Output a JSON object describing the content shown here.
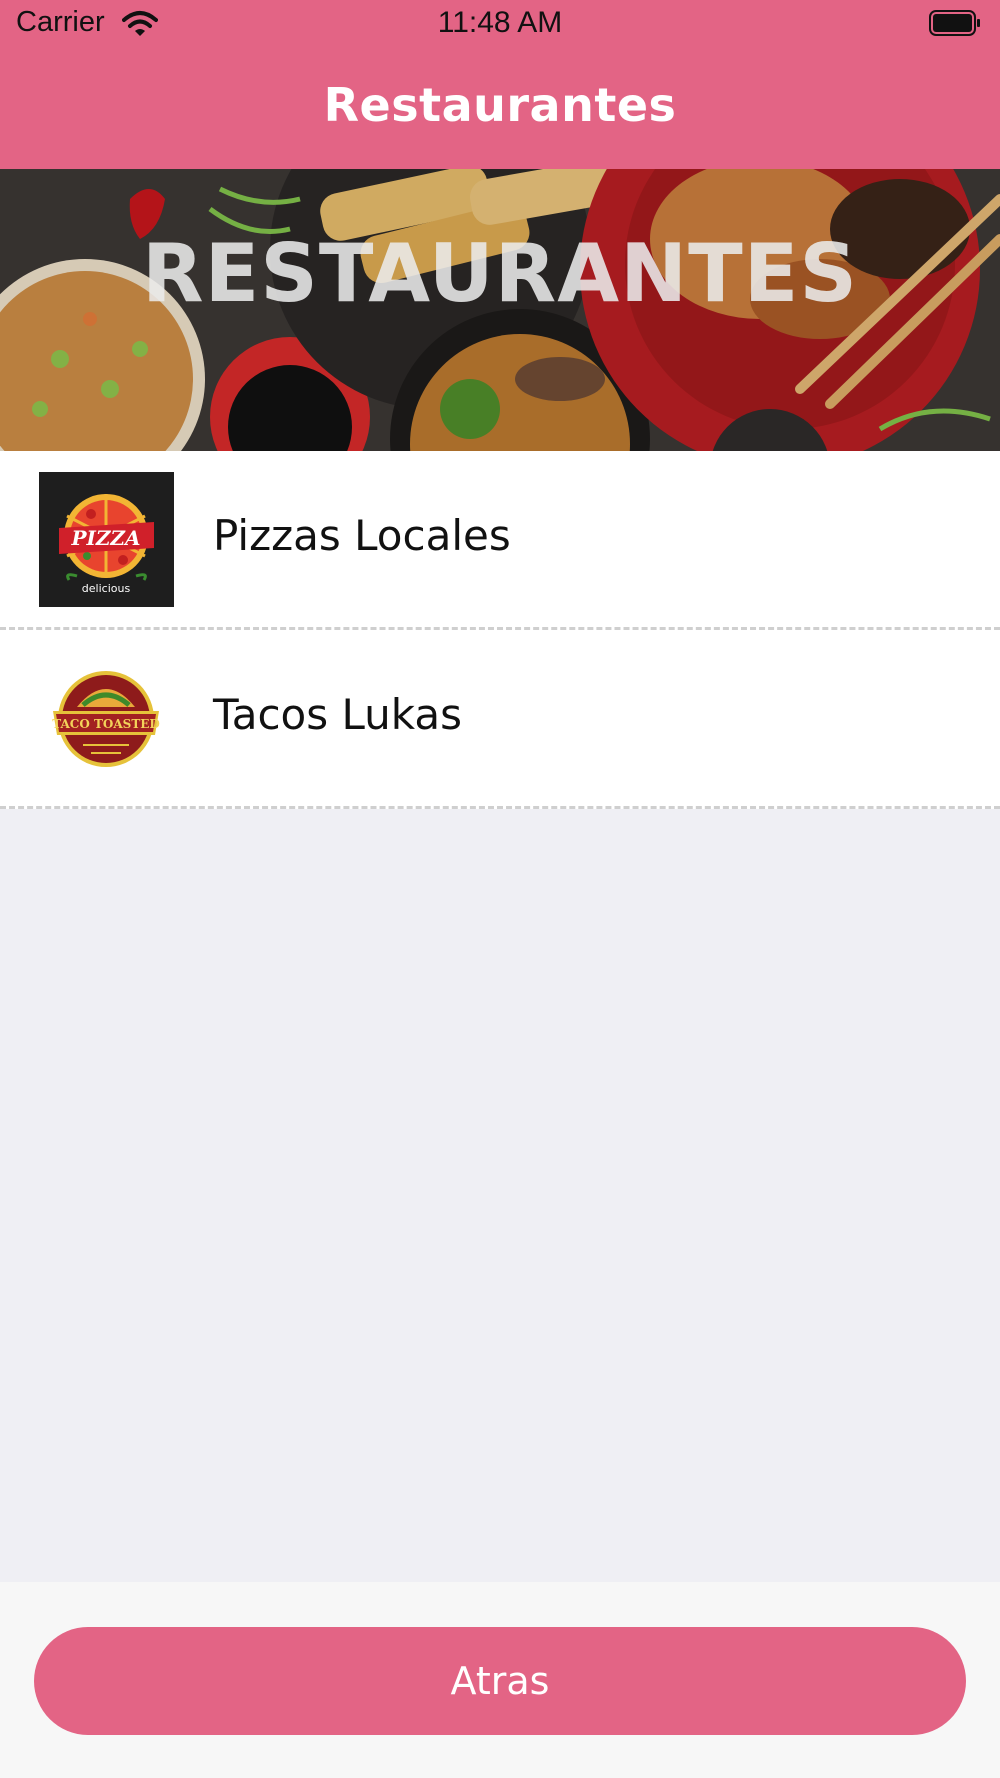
{
  "status_bar": {
    "carrier": "Carrier",
    "time": "11:48 AM"
  },
  "nav": {
    "title": "Restaurantes"
  },
  "banner": {
    "title": "RESTAURANTES"
  },
  "restaurants": [
    {
      "name": "Pizzas Locales",
      "logo_icon": "pizza-logo-icon"
    },
    {
      "name": "Tacos Lukas",
      "logo_icon": "taco-logo-icon"
    }
  ],
  "logos": {
    "pizza": {
      "word": "PIZZA",
      "tagline": "delicious"
    },
    "taco": {
      "word": "TACO TOASTED"
    }
  },
  "footer": {
    "back_label": "Atras"
  },
  "colors": {
    "accent": "#e36485",
    "background": "#efeff4",
    "separator": "#cfcfcf"
  }
}
